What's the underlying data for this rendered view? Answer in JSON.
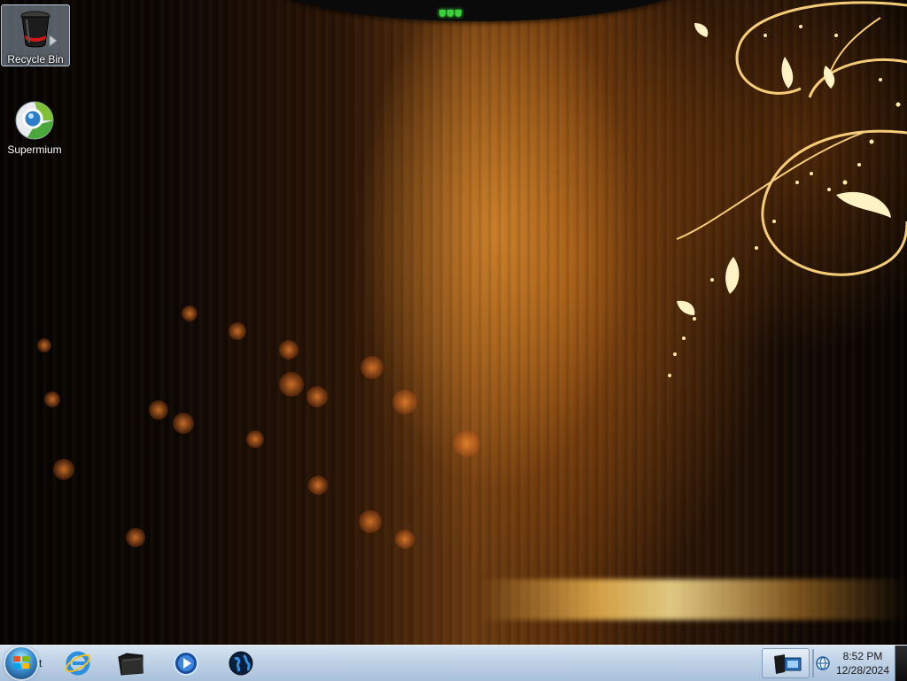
{
  "desktop": {
    "icons": [
      {
        "label": "Recycle Bin",
        "icon": "recycle-bin-icon",
        "selected": true
      },
      {
        "label": "Supermium",
        "icon": "supermium-browser-icon",
        "selected": false
      }
    ]
  },
  "taskbar": {
    "start": {
      "icon": "windows-start-orb-icon",
      "text": "t"
    },
    "apps": [
      {
        "name": "internet-explorer",
        "icon": "internet-explorer-icon"
      },
      {
        "name": "explorer-folder",
        "icon": "black-folder-icon"
      },
      {
        "name": "media-player",
        "icon": "media-player-icon"
      },
      {
        "name": "globe-browser",
        "icon": "globe-icon"
      }
    ],
    "tray": {
      "active_icon": "network-monitor-icon",
      "small_icon": "tray-globe-icon"
    },
    "clock": {
      "time": "8:52 PM",
      "date": "12/28/2024"
    }
  },
  "colors": {
    "taskbar_top": "#d7e4f1",
    "taskbar_bottom": "#a9c0da",
    "wallpaper_accent": "#ffb84a"
  }
}
